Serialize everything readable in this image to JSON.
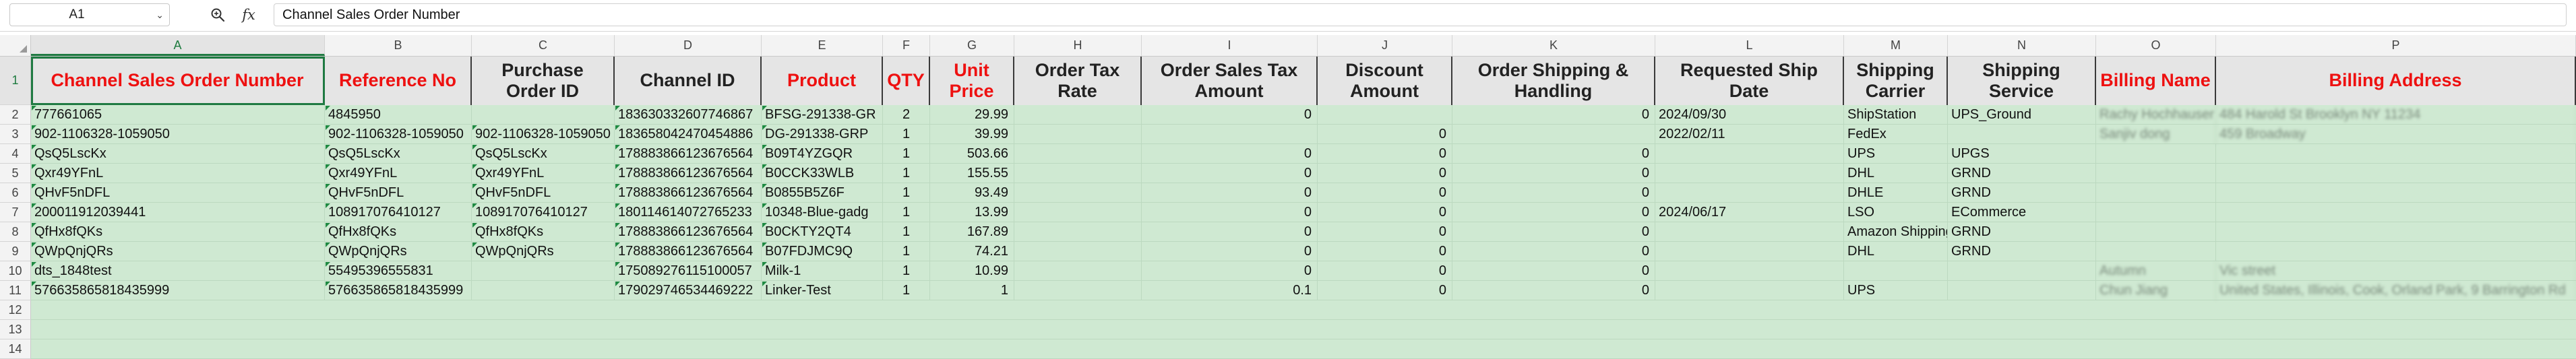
{
  "formula_bar": {
    "cell_ref": "A1",
    "content": "Channel Sales Order Number",
    "zoom_icon": "zoom-search-icon",
    "fx_label": "fx"
  },
  "columns": [
    {
      "letter": "A",
      "header": "Channel Sales Order Number",
      "header_color": "red"
    },
    {
      "letter": "B",
      "header": "Reference No",
      "header_color": "red"
    },
    {
      "letter": "C",
      "header": "Purchase Order ID",
      "header_color": "black"
    },
    {
      "letter": "D",
      "header": "Channel ID",
      "header_color": "black"
    },
    {
      "letter": "E",
      "header": "Product",
      "header_color": "red"
    },
    {
      "letter": "F",
      "header": "QTY",
      "header_color": "red"
    },
    {
      "letter": "G",
      "header": "Unit Price",
      "header_color": "red"
    },
    {
      "letter": "H",
      "header": "Order Tax Rate",
      "header_color": "black"
    },
    {
      "letter": "I",
      "header": "Order Sales Tax Amount",
      "header_color": "black"
    },
    {
      "letter": "J",
      "header": "Discount Amount",
      "header_color": "black"
    },
    {
      "letter": "K",
      "header": "Order Shipping & Handling",
      "header_color": "black"
    },
    {
      "letter": "L",
      "header": "Requested Ship Date",
      "header_color": "black"
    },
    {
      "letter": "M",
      "header": "Shipping Carrier",
      "header_color": "black"
    },
    {
      "letter": "N",
      "header": "Shipping Service",
      "header_color": "black"
    },
    {
      "letter": "O",
      "header": "Billing Name",
      "header_color": "red"
    },
    {
      "letter": "P",
      "header": "Billing Address",
      "header_color": "red"
    }
  ],
  "row_numbers": [
    "1",
    "2",
    "3",
    "4",
    "5",
    "6",
    "7",
    "8",
    "9",
    "10",
    "11",
    "12",
    "13",
    "14"
  ],
  "rows": [
    [
      "777661065",
      "4845950",
      "",
      "183630332607746867",
      "BFSG-291338-GR",
      "2",
      "29.99",
      "",
      "0",
      "",
      "0",
      "2024/09/30",
      "ShipStation",
      "UPS_Ground",
      "Rachy Hochhauser",
      "484 Harold St Brooklyn NY 11234"
    ],
    [
      "902-1106328-1059050",
      "902-1106328-1059050",
      "902-1106328-1059050",
      "183658042470454886",
      "DG-291338-GRP",
      "1",
      "39.99",
      "",
      "",
      "0",
      "",
      "2022/02/11",
      "FedEx",
      "",
      "Sanjiv dong",
      "459 Broadway"
    ],
    [
      "QsQ5LscKx",
      "QsQ5LscKx",
      "QsQ5LscKx",
      "178883866123676564",
      "B09T4YZGQR",
      "1",
      "503.66",
      "",
      "0",
      "0",
      "0",
      "",
      "UPS",
      "UPGS",
      "",
      ""
    ],
    [
      "Qxr49YFnL",
      "Qxr49YFnL",
      "Qxr49YFnL",
      "178883866123676564",
      "B0CCK33WLB",
      "1",
      "155.55",
      "",
      "0",
      "0",
      "0",
      "",
      "DHL",
      "GRND",
      "",
      ""
    ],
    [
      "QHvF5nDFL",
      "QHvF5nDFL",
      "QHvF5nDFL",
      "178883866123676564",
      "B0855B5Z6F",
      "1",
      "93.49",
      "",
      "0",
      "0",
      "0",
      "",
      "DHLE",
      "GRND",
      "",
      ""
    ],
    [
      "200011912039441",
      "108917076410127",
      "108917076410127",
      "180114614072765233",
      "10348-Blue-gadg",
      "1",
      "13.99",
      "",
      "0",
      "0",
      "0",
      "2024/06/17",
      "LSO",
      "ECommerce",
      "",
      ""
    ],
    [
      "QfHx8fQKs",
      "QfHx8fQKs",
      "QfHx8fQKs",
      "178883866123676564",
      "B0CKTY2QT4",
      "1",
      "167.89",
      "",
      "0",
      "0",
      "0",
      "",
      "Amazon Shipping",
      "GRND",
      "",
      ""
    ],
    [
      "QWpQnjQRs",
      "QWpQnjQRs",
      "QWpQnjQRs",
      "178883866123676564",
      "B07FDJMC9Q",
      "1",
      "74.21",
      "",
      "0",
      "0",
      "0",
      "",
      "DHL",
      "GRND",
      "",
      ""
    ],
    [
      "dts_1848test",
      "55495396555831",
      "",
      "175089276115100057",
      "Milk-1",
      "1",
      "10.99",
      "",
      "0",
      "0",
      "0",
      "",
      "",
      "",
      "Autumn",
      "Vic street"
    ],
    [
      "576635865818435999",
      "576635865818435999",
      "",
      "179029746534469222",
      "Linker-Test",
      "1",
      "1",
      "",
      "0.1",
      "0",
      "0",
      "",
      "UPS",
      "",
      "Chun Jiang",
      "United States, Illinois, Cook, Orland Park, 9 Barrington Rd"
    ]
  ]
}
